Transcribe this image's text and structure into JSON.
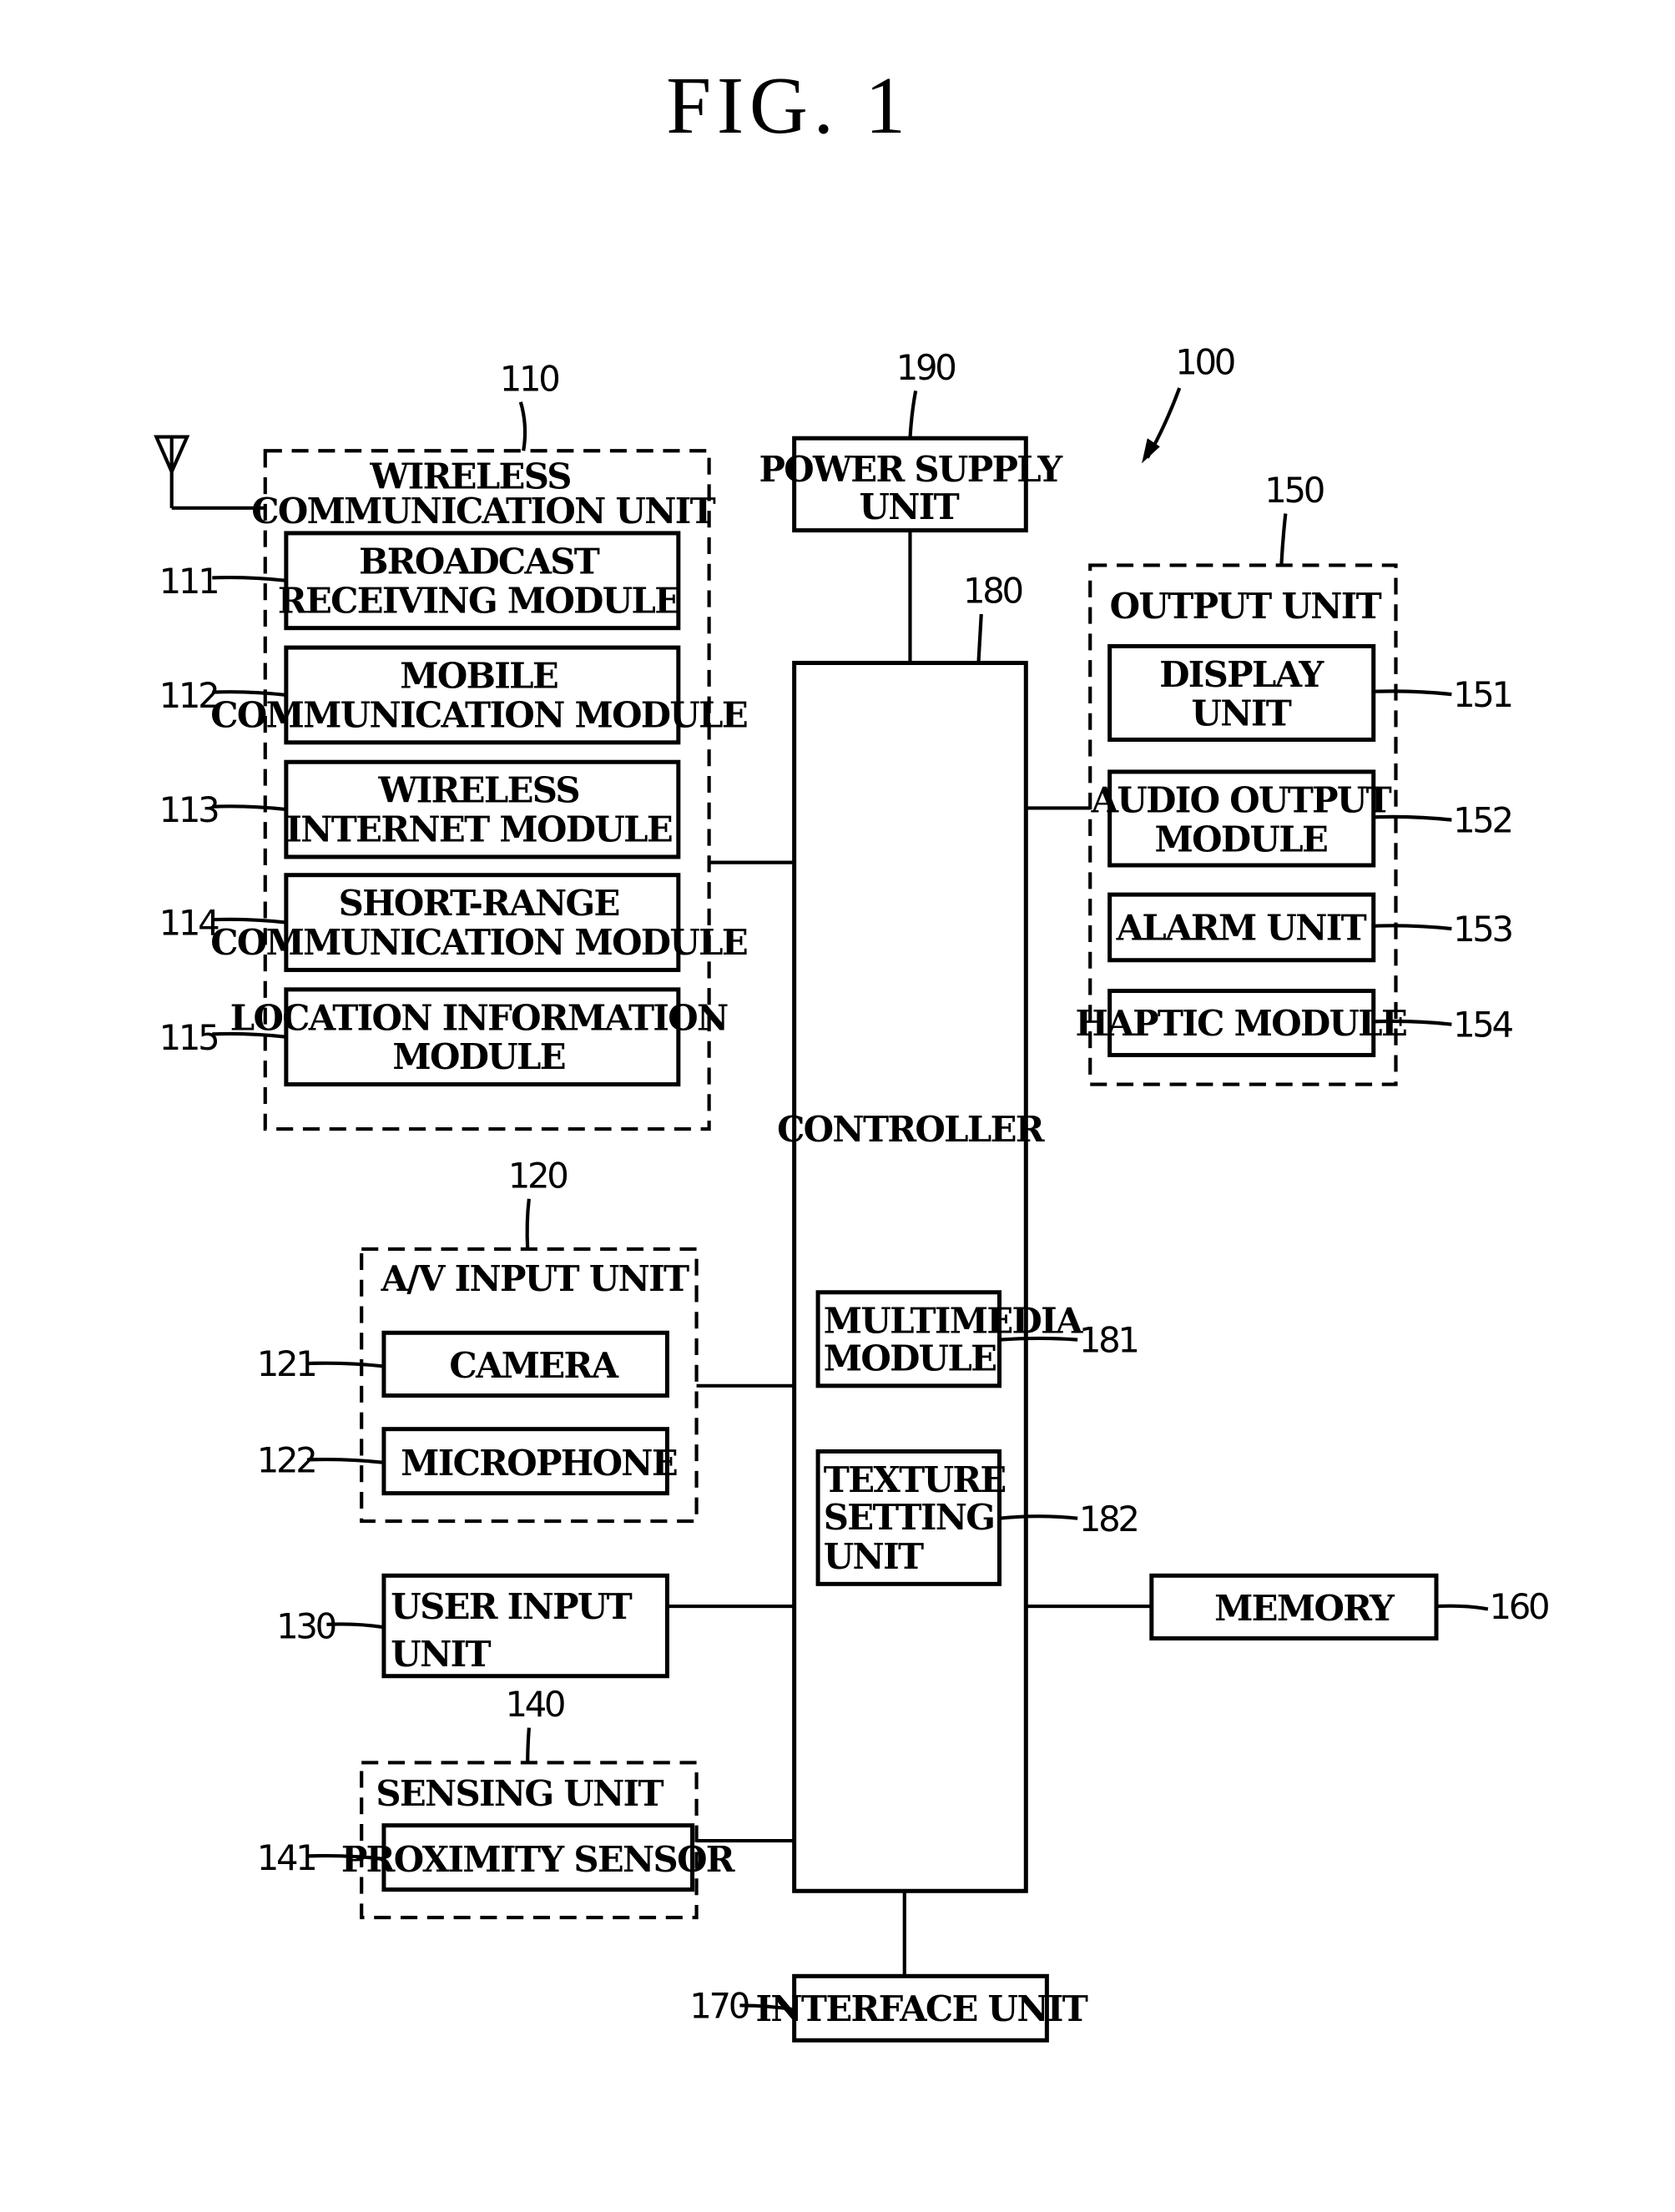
{
  "figure": {
    "title": "FIG. 1",
    "device_ref": "100"
  },
  "wireless": {
    "ref": "110",
    "title_1": "WIRELESS",
    "title_2": "COMMUNICATION UNIT",
    "modules": [
      {
        "ref": "111",
        "line1": "BROADCAST",
        "line2": "RECEIVING MODULE"
      },
      {
        "ref": "112",
        "line1": "MOBILE",
        "line2": "COMMUNICATION MODULE"
      },
      {
        "ref": "113",
        "line1": "WIRELESS",
        "line2": "INTERNET MODULE"
      },
      {
        "ref": "114",
        "line1": "SHORT-RANGE",
        "line2": "COMMUNICATION MODULE"
      },
      {
        "ref": "115",
        "line1": "LOCATION INFORMATION",
        "line2": "MODULE"
      }
    ]
  },
  "av_input": {
    "ref": "120",
    "title": "A/V INPUT UNIT",
    "items": [
      {
        "ref": "121",
        "label": "CAMERA"
      },
      {
        "ref": "122",
        "label": "MICROPHONE"
      }
    ]
  },
  "user_input": {
    "ref": "130",
    "line1": "USER INPUT",
    "line2": "UNIT"
  },
  "sensing": {
    "ref": "140",
    "title": "SENSING UNIT",
    "item": {
      "ref": "141",
      "label": "PROXIMITY SENSOR"
    }
  },
  "output": {
    "ref": "150",
    "title": "OUTPUT UNIT",
    "items": [
      {
        "ref": "151",
        "line1": "DISPLAY",
        "line2": "UNIT"
      },
      {
        "ref": "152",
        "line1": "AUDIO OUTPUT",
        "line2": "MODULE"
      },
      {
        "ref": "153",
        "line1": "ALARM UNIT",
        "line2": ""
      },
      {
        "ref": "154",
        "line1": "HAPTIC MODULE",
        "line2": ""
      }
    ]
  },
  "memory": {
    "ref": "160",
    "label": "MEMORY"
  },
  "interface": {
    "ref": "170",
    "label": "INTERFACE UNIT"
  },
  "controller": {
    "ref": "180",
    "label": "CONTROLLER",
    "multimedia": {
      "ref": "181",
      "line1": "MULTIMEDIA",
      "line2": "MODULE"
    },
    "texture": {
      "ref": "182",
      "line1": "TEXTURE",
      "line2": "SETTING",
      "line3": "UNIT"
    }
  },
  "power": {
    "ref": "190",
    "line1": "POWER SUPPLY",
    "line2": "UNIT"
  }
}
